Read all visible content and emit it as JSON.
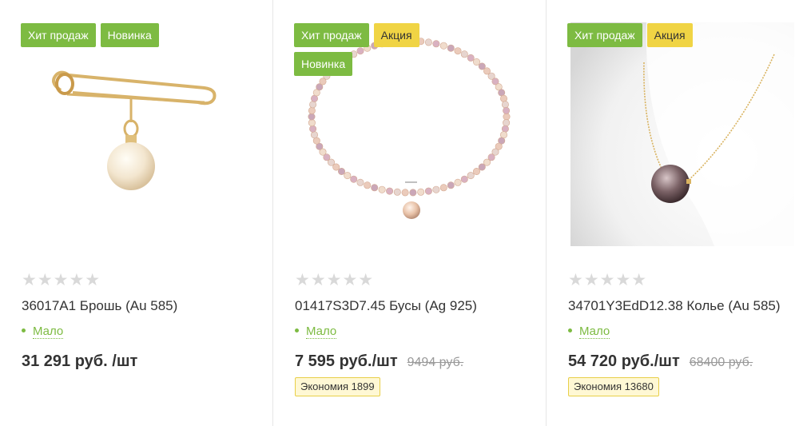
{
  "products": [
    {
      "stickers": [
        {
          "label": "Хит продаж",
          "color": "#7dbb42"
        },
        {
          "label": "Новинка",
          "color": "#7dbb42"
        }
      ],
      "image_icon": "pearl-pin-brooch",
      "rating": "★★★★★",
      "name": "36017A1 Брошь (Au 585)",
      "stock": "Мало",
      "price": "31 291 руб. /шт",
      "old_price": "",
      "economy": ""
    },
    {
      "stickers": [
        {
          "label": "Хит продаж",
          "color": "#7dbb42"
        },
        {
          "label": "Акция",
          "color": "#f0d444"
        },
        {
          "label": "Новинка",
          "color": "#7dbb42"
        }
      ],
      "image_icon": "pearl-necklace",
      "rating": "★★★★★",
      "name": "01417S3D7.45 Бусы (Ag 925)",
      "stock": "Мало",
      "price": "7 595 руб./шт",
      "old_price": "9494 руб.",
      "economy": "Экономия 1899"
    },
    {
      "stickers": [
        {
          "label": "Хит продаж",
          "color": "#7dbb42"
        },
        {
          "label": "Акция",
          "color": "#f0d444"
        }
      ],
      "image_icon": "pearl-pendant-chain",
      "rating": "★★★★★",
      "name": "34701Y3EdD12.38 Колье (Au 585)",
      "stock": "Мало",
      "price": "54 720 руб./шт",
      "old_price": "68400 руб.",
      "economy": "Экономия 13680"
    }
  ]
}
